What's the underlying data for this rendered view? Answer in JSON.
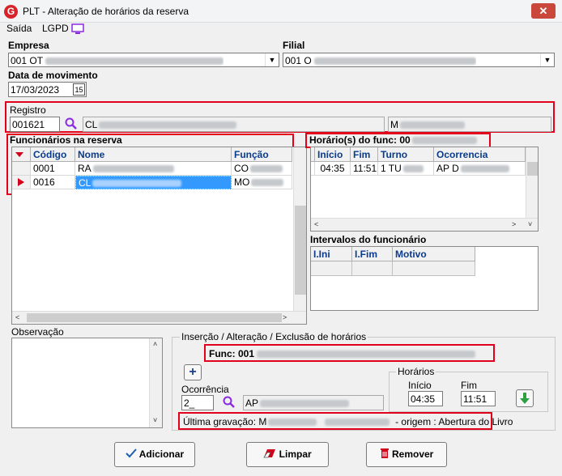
{
  "window": {
    "title": "PLT - Alteração de horários da reserva",
    "logo": "G",
    "close": "✕"
  },
  "menu": {
    "saida": "Saída",
    "lgpd": "LGPD"
  },
  "empresa": {
    "label": "Empresa",
    "value": "001 OT"
  },
  "filial": {
    "label": "Filial",
    "value": "001 O"
  },
  "data_movimento": {
    "label": "Data de movimento",
    "value": "17/03/2023",
    "calendar": "15"
  },
  "registro": {
    "label": "Registro",
    "code": "001621",
    "name_prefix": "CL",
    "role_prefix": "M"
  },
  "funcionarios": {
    "title": "Funcionários na reserva",
    "columns": [
      "Código",
      "Nome",
      "Função"
    ],
    "rows": [
      {
        "codigo": "0001",
        "nome": "RA",
        "funcao": "CO"
      },
      {
        "codigo": "0016",
        "nome": "CL",
        "funcao": "MO"
      }
    ]
  },
  "horarios": {
    "title": "Horário(s) do func: 00",
    "columns": [
      "Início",
      "Fim",
      "Turno",
      "Ocorrencia"
    ],
    "rows": [
      {
        "inicio": "04:35",
        "fim": "11:51",
        "turno": "1 TU",
        "ocorrencia": "AP D"
      }
    ]
  },
  "intervalos": {
    "title": "Intervalos do funcionário",
    "columns": [
      "I.Ini",
      "I.Fim",
      "Motivo"
    ]
  },
  "observacao": {
    "label": "Observação"
  },
  "insercao": {
    "group_title": "Inserção / Alteração / Exclusão de horários",
    "func_label": "Func: 001",
    "add": "+",
    "ocorrencia_label": "Ocorrência",
    "ocorrencia_code": "2_",
    "ocorrencia_desc": "AP",
    "horarios_label": "Horários",
    "inicio_label": "Início",
    "inicio_value": "04:35",
    "fim_label": "Fim",
    "fim_value": "11:51",
    "ultima_prefix": "Última gravação: M",
    "ultima_origem": "- origem : Abertura do Livro"
  },
  "buttons": {
    "adicionar": "Adicionar",
    "limpar": "Limpar",
    "remover": "Remover"
  },
  "colors": {
    "highlight_red": "#e3001b",
    "selection_blue": "#3399ff",
    "header_text": "#0a3b8c"
  }
}
